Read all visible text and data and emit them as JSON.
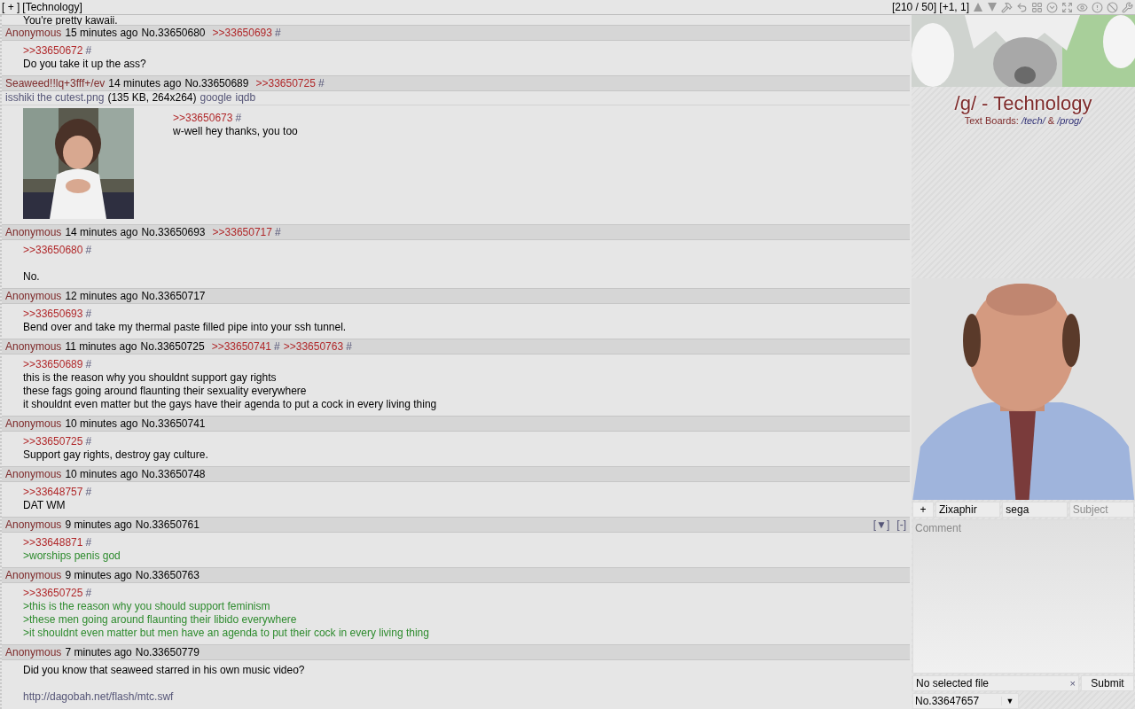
{
  "top_bar": {
    "toggle": "[ + ]",
    "board": "[Technology]",
    "counts": "[210 / 50] [+1, 1]"
  },
  "cut_post_text": "You're pretty kawaii.",
  "posts": [
    {
      "name": "Anonymous",
      "time": "15 minutes ago",
      "number": "No.33650680",
      "backlinks": [
        {
          "ref": ">>33650693",
          "mark": "#"
        }
      ],
      "lines": [
        {
          "kind": "quote",
          "text": ">>33650672",
          "mark": "#"
        },
        {
          "kind": "text",
          "text": "Do you take it up the ass?"
        }
      ]
    },
    {
      "name": "Seaweed",
      "trip": "!!lq+3fff+/ev",
      "time": "14 minutes ago",
      "number": "No.33650689",
      "backlinks": [
        {
          "ref": ">>33650725",
          "mark": "#"
        }
      ],
      "file": {
        "name": "isshiki the cutest.png",
        "info": "(135 KB, 264x264)",
        "links": [
          "google",
          "iqdb"
        ],
        "kind": "picture"
      },
      "lines": [
        {
          "kind": "quote",
          "text": ">>33650673",
          "mark": "#"
        },
        {
          "kind": "text",
          "text": "w-well hey thanks, you too"
        }
      ]
    },
    {
      "name": "Anonymous",
      "time": "14 minutes ago",
      "number": "No.33650693",
      "backlinks": [
        {
          "ref": ">>33650717",
          "mark": "#"
        }
      ],
      "lines": [
        {
          "kind": "quote",
          "text": ">>33650680",
          "mark": "#"
        },
        {
          "kind": "blank"
        },
        {
          "kind": "text",
          "text": "No."
        }
      ]
    },
    {
      "name": "Anonymous",
      "time": "12 minutes ago",
      "number": "No.33650717",
      "lines": [
        {
          "kind": "quote",
          "text": ">>33650693",
          "mark": "#"
        },
        {
          "kind": "text",
          "text": "Bend over and take my thermal paste filled pipe into your ssh tunnel."
        }
      ]
    },
    {
      "name": "Anonymous",
      "time": "11 minutes ago",
      "number": "No.33650725",
      "backlinks": [
        {
          "ref": ">>33650741",
          "mark": "#"
        },
        {
          "ref": ">>33650763",
          "mark": "#"
        }
      ],
      "lines": [
        {
          "kind": "quote",
          "text": ">>33650689",
          "mark": "#"
        },
        {
          "kind": "text",
          "text": "this is the reason why you shouldnt support gay rights"
        },
        {
          "kind": "text",
          "text": "these fags going around flaunting their sexuality everywhere"
        },
        {
          "kind": "text",
          "text": "it shouldnt even matter but the gays have their agenda to put a cock in every living thing"
        }
      ]
    },
    {
      "name": "Anonymous",
      "time": "10 minutes ago",
      "number": "No.33650741",
      "lines": [
        {
          "kind": "quote",
          "text": ">>33650725",
          "mark": "#"
        },
        {
          "kind": "text",
          "text": "Support gay rights, destroy gay culture."
        }
      ]
    },
    {
      "name": "Anonymous",
      "time": "10 minutes ago",
      "number": "No.33650748",
      "lines": [
        {
          "kind": "quote",
          "text": ">>33648757",
          "mark": "#"
        },
        {
          "kind": "text",
          "text": "DAT WM"
        }
      ]
    },
    {
      "name": "Anonymous",
      "time": "9 minutes ago",
      "number": "No.33650761",
      "controls": [
        "[▼]",
        "[-]"
      ],
      "lines": [
        {
          "kind": "quote",
          "text": ">>33648871",
          "mark": "#"
        },
        {
          "kind": "green",
          "text": ">worships penis god"
        }
      ]
    },
    {
      "name": "Anonymous",
      "time": "9 minutes ago",
      "number": "No.33650763",
      "lines": [
        {
          "kind": "quote",
          "text": ">>33650725",
          "mark": "#"
        },
        {
          "kind": "green",
          "text": ">this is the reason why you should support feminism"
        },
        {
          "kind": "green",
          "text": ">these men going around flaunting their libido everywhere"
        },
        {
          "kind": "green",
          "text": ">it shouldnt even matter but men have an agenda to put their cock in every living thing"
        }
      ]
    },
    {
      "name": "Anonymous",
      "time": "7 minutes ago",
      "number": "No.33650779",
      "lines": [
        {
          "kind": "text",
          "text": "Did you know that seaweed starred in his own music video?"
        },
        {
          "kind": "blank"
        },
        {
          "kind": "link",
          "text": "http://dagobah.net/flash/mtc.swf"
        }
      ]
    }
  ],
  "sidebar": {
    "title": "/g/ - Technology",
    "subtitle": "Text Boards:",
    "boards": [
      "/tech/",
      "&",
      "/prog/"
    ]
  },
  "form": {
    "expand": "+",
    "name": "Zixaphir",
    "email": "sega",
    "subject_placeholder": "Subject",
    "comment_placeholder": "Comment",
    "file": "No selected file",
    "clear": "×",
    "submit": "Submit",
    "thread": "No.33647657",
    "thread_caret": "▼"
  }
}
